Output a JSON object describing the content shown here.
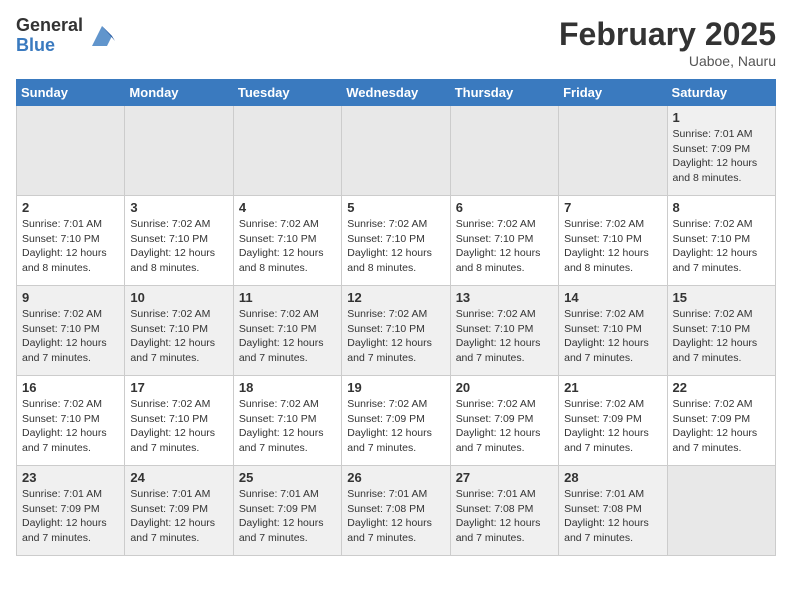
{
  "logo": {
    "general": "General",
    "blue": "Blue"
  },
  "title": {
    "month_year": "February 2025",
    "location": "Uaboe, Nauru"
  },
  "weekdays": [
    "Sunday",
    "Monday",
    "Tuesday",
    "Wednesday",
    "Thursday",
    "Friday",
    "Saturday"
  ],
  "weeks": [
    [
      {
        "day": "",
        "info": ""
      },
      {
        "day": "",
        "info": ""
      },
      {
        "day": "",
        "info": ""
      },
      {
        "day": "",
        "info": ""
      },
      {
        "day": "",
        "info": ""
      },
      {
        "day": "",
        "info": ""
      },
      {
        "day": "1",
        "info": "Sunrise: 7:01 AM\nSunset: 7:09 PM\nDaylight: 12 hours\nand 8 minutes."
      }
    ],
    [
      {
        "day": "2",
        "info": "Sunrise: 7:01 AM\nSunset: 7:10 PM\nDaylight: 12 hours\nand 8 minutes."
      },
      {
        "day": "3",
        "info": "Sunrise: 7:02 AM\nSunset: 7:10 PM\nDaylight: 12 hours\nand 8 minutes."
      },
      {
        "day": "4",
        "info": "Sunrise: 7:02 AM\nSunset: 7:10 PM\nDaylight: 12 hours\nand 8 minutes."
      },
      {
        "day": "5",
        "info": "Sunrise: 7:02 AM\nSunset: 7:10 PM\nDaylight: 12 hours\nand 8 minutes."
      },
      {
        "day": "6",
        "info": "Sunrise: 7:02 AM\nSunset: 7:10 PM\nDaylight: 12 hours\nand 8 minutes."
      },
      {
        "day": "7",
        "info": "Sunrise: 7:02 AM\nSunset: 7:10 PM\nDaylight: 12 hours\nand 8 minutes."
      },
      {
        "day": "8",
        "info": "Sunrise: 7:02 AM\nSunset: 7:10 PM\nDaylight: 12 hours\nand 7 minutes."
      }
    ],
    [
      {
        "day": "9",
        "info": "Sunrise: 7:02 AM\nSunset: 7:10 PM\nDaylight: 12 hours\nand 7 minutes."
      },
      {
        "day": "10",
        "info": "Sunrise: 7:02 AM\nSunset: 7:10 PM\nDaylight: 12 hours\nand 7 minutes."
      },
      {
        "day": "11",
        "info": "Sunrise: 7:02 AM\nSunset: 7:10 PM\nDaylight: 12 hours\nand 7 minutes."
      },
      {
        "day": "12",
        "info": "Sunrise: 7:02 AM\nSunset: 7:10 PM\nDaylight: 12 hours\nand 7 minutes."
      },
      {
        "day": "13",
        "info": "Sunrise: 7:02 AM\nSunset: 7:10 PM\nDaylight: 12 hours\nand 7 minutes."
      },
      {
        "day": "14",
        "info": "Sunrise: 7:02 AM\nSunset: 7:10 PM\nDaylight: 12 hours\nand 7 minutes."
      },
      {
        "day": "15",
        "info": "Sunrise: 7:02 AM\nSunset: 7:10 PM\nDaylight: 12 hours\nand 7 minutes."
      }
    ],
    [
      {
        "day": "16",
        "info": "Sunrise: 7:02 AM\nSunset: 7:10 PM\nDaylight: 12 hours\nand 7 minutes."
      },
      {
        "day": "17",
        "info": "Sunrise: 7:02 AM\nSunset: 7:10 PM\nDaylight: 12 hours\nand 7 minutes."
      },
      {
        "day": "18",
        "info": "Sunrise: 7:02 AM\nSunset: 7:10 PM\nDaylight: 12 hours\nand 7 minutes."
      },
      {
        "day": "19",
        "info": "Sunrise: 7:02 AM\nSunset: 7:09 PM\nDaylight: 12 hours\nand 7 minutes."
      },
      {
        "day": "20",
        "info": "Sunrise: 7:02 AM\nSunset: 7:09 PM\nDaylight: 12 hours\nand 7 minutes."
      },
      {
        "day": "21",
        "info": "Sunrise: 7:02 AM\nSunset: 7:09 PM\nDaylight: 12 hours\nand 7 minutes."
      },
      {
        "day": "22",
        "info": "Sunrise: 7:02 AM\nSunset: 7:09 PM\nDaylight: 12 hours\nand 7 minutes."
      }
    ],
    [
      {
        "day": "23",
        "info": "Sunrise: 7:01 AM\nSunset: 7:09 PM\nDaylight: 12 hours\nand 7 minutes."
      },
      {
        "day": "24",
        "info": "Sunrise: 7:01 AM\nSunset: 7:09 PM\nDaylight: 12 hours\nand 7 minutes."
      },
      {
        "day": "25",
        "info": "Sunrise: 7:01 AM\nSunset: 7:09 PM\nDaylight: 12 hours\nand 7 minutes."
      },
      {
        "day": "26",
        "info": "Sunrise: 7:01 AM\nSunset: 7:08 PM\nDaylight: 12 hours\nand 7 minutes."
      },
      {
        "day": "27",
        "info": "Sunrise: 7:01 AM\nSunset: 7:08 PM\nDaylight: 12 hours\nand 7 minutes."
      },
      {
        "day": "28",
        "info": "Sunrise: 7:01 AM\nSunset: 7:08 PM\nDaylight: 12 hours\nand 7 minutes."
      },
      {
        "day": "",
        "info": ""
      }
    ]
  ]
}
